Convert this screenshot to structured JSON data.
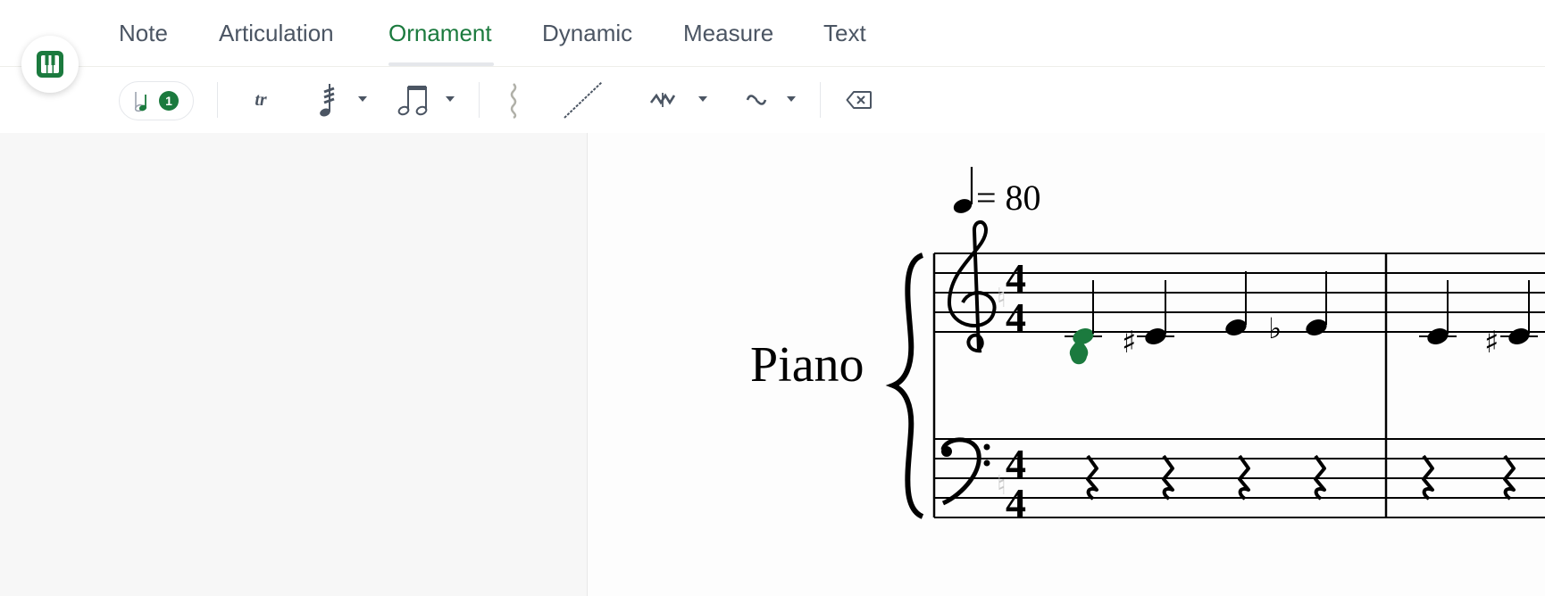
{
  "tabs": [
    {
      "label": "Note"
    },
    {
      "label": "Articulation"
    },
    {
      "label": "Ornament"
    },
    {
      "label": "Dynamic"
    },
    {
      "label": "Measure"
    },
    {
      "label": "Text"
    }
  ],
  "active_tab": "Ornament",
  "toolbar": {
    "selected_count": "1",
    "trill_label": "tr"
  },
  "score": {
    "tempo_value": "= 80",
    "instrument": "Piano",
    "time_signature_top": "4",
    "time_signature_bottom": "4"
  },
  "colors": {
    "accent": "#1b7a3e",
    "tab_text": "#4b5563",
    "icon": "#4b5563"
  }
}
